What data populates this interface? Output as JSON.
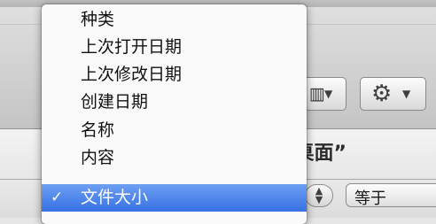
{
  "menu": {
    "items": [
      {
        "label": "种类"
      },
      {
        "label": "上次打开日期"
      },
      {
        "label": "上次修改日期"
      },
      {
        "label": "创建日期"
      },
      {
        "label": "名称"
      },
      {
        "label": "内容"
      },
      {
        "label": "文件大小",
        "checkmark": "✓"
      }
    ],
    "selected_index": 6
  },
  "search_scope_title": "“桌面”",
  "rule": {
    "operator_label": "等于"
  },
  "icons": {
    "view": "view-icon",
    "view_caret": "caret-down-icon",
    "gear": "gear-icon",
    "stepper": "up-down-arrows-icon"
  },
  "colors": {
    "selection_top": "#6d9ff2",
    "selection_bottom": "#3771e4",
    "menu_background": "#fafafa"
  }
}
